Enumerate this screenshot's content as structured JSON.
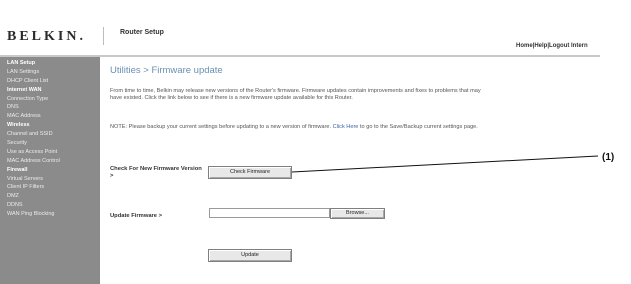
{
  "header": {
    "logo": "BELKIN.",
    "section_title": "Router Setup",
    "top_links": "Home|Help|Logout  Intern"
  },
  "sidebar": {
    "items": [
      {
        "label": "LAN Setup",
        "header": true
      },
      {
        "label": "LAN Settings",
        "header": false
      },
      {
        "label": "DHCP Client List",
        "header": false
      },
      {
        "label": "Internet WAN",
        "header": true
      },
      {
        "label": "Connection Type",
        "header": false
      },
      {
        "label": "DNS",
        "header": false
      },
      {
        "label": "MAC Address",
        "header": false
      },
      {
        "label": "Wireless",
        "header": true
      },
      {
        "label": "Channel and SSID",
        "header": false
      },
      {
        "label": "Security",
        "header": false
      },
      {
        "label": "Use as Access Point",
        "header": false
      },
      {
        "label": "MAC Address Control",
        "header": false
      },
      {
        "label": "Firewall",
        "header": true
      },
      {
        "label": "Virtual Servers",
        "header": false
      },
      {
        "label": "Client IP Filters",
        "header": false
      },
      {
        "label": "DMZ",
        "header": false
      },
      {
        "label": "DDNS",
        "header": false
      },
      {
        "label": "WAN Ping Blocking",
        "header": false
      }
    ]
  },
  "main": {
    "title": "Utilities > Firmware update",
    "description": "From time to time, Belkin may release new versions of the Router's firmware. Firmware updates contain improvements and fixes to problems that may have existed. Click the link below to see if there is a new firmware update available for this Router.",
    "note_text": "NOTE: Please backup your current settings before updating to a new version of firmware. ",
    "note_link": "Click Here",
    "note_tail": " to go to the Save/Backup current settings page.",
    "check_label": "Check For New Firmware Version >",
    "check_button": "Check Firmware",
    "update_label": "Update Firmware >",
    "browse_button": "Browse...",
    "update_button": "Update"
  },
  "callout": {
    "label": "(1)"
  }
}
